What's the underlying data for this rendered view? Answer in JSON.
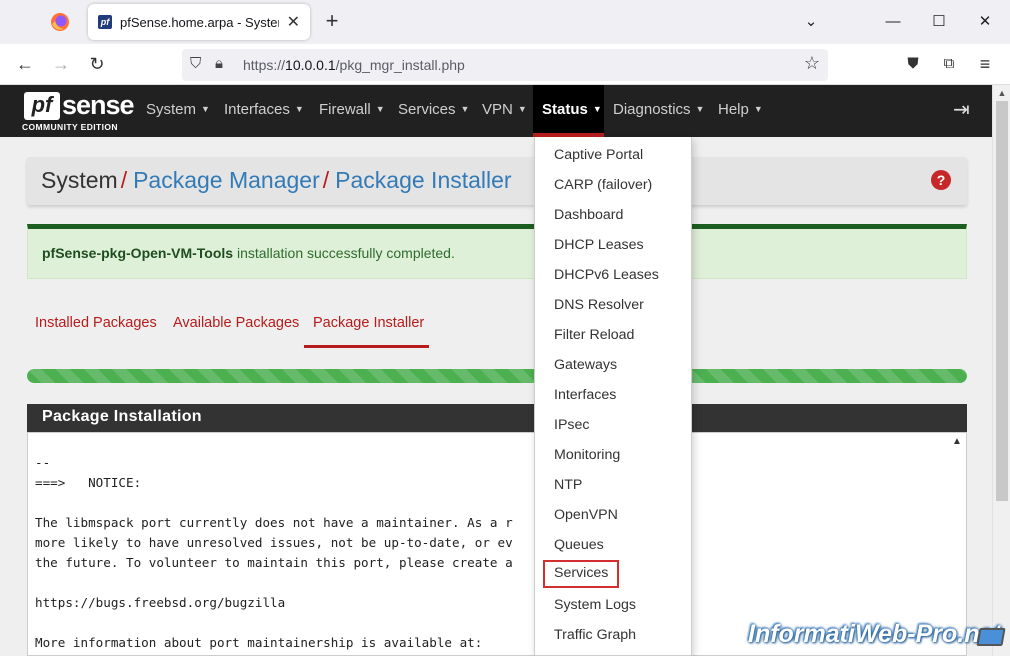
{
  "browser": {
    "tab_title": "pfSense.home.arpa - System: Pa",
    "tab_favicon": "pf",
    "url_prefix": "https://",
    "url_host": "10.0.0.1",
    "url_path": "/pkg_mgr_install.php"
  },
  "pfsense": {
    "logo_pf": "pf",
    "logo_sense": "sense",
    "logo_edition": "COMMUNITY EDITION",
    "menu": [
      "System",
      "Interfaces",
      "Firewall",
      "Services",
      "VPN",
      "Status",
      "Diagnostics",
      "Help"
    ],
    "active_menu": "Status"
  },
  "breadcrumb": {
    "root": "System",
    "sep": "/",
    "level1": "Package Manager",
    "level2": "Package Installer"
  },
  "alert": {
    "package": "pfSense-pkg-Open-VM-Tools",
    "message": " installation successfully completed."
  },
  "tabs": [
    "Installed Packages",
    "Available Packages",
    "Package Installer"
  ],
  "active_tab": "Package Installer",
  "progress": 1.0,
  "panel": {
    "title": "Package Installation",
    "console_lines": [
      "--",
      "===>   NOTICE:",
      "",
      "The libmspack port currently does not have a maintainer. As a r",
      "more likely to have unresolved issues, not be up-to-date, or ev",
      "the future. To volunteer to maintain this port, please create a",
      "",
      "https://bugs.freebsd.org/bugzilla",
      "",
      "More information about port maintainership is available at:"
    ]
  },
  "status_menu": {
    "items": [
      "Captive Portal",
      "CARP (failover)",
      "Dashboard",
      "DHCP Leases",
      "DHCPv6 Leases",
      "DNS Resolver",
      "Filter Reload",
      "Gateways",
      "Interfaces",
      "IPsec",
      "Monitoring",
      "NTP",
      "OpenVPN",
      "Queues",
      "Services",
      "System Logs",
      "Traffic Graph"
    ],
    "highlighted": "Services"
  },
  "watermark": "InformatiWeb-Pro.net",
  "colors": {
    "accent_red": "#b71c1c",
    "nav_bg": "#212121",
    "link_blue": "#337ab7",
    "success_bg": "#dff0d8"
  }
}
